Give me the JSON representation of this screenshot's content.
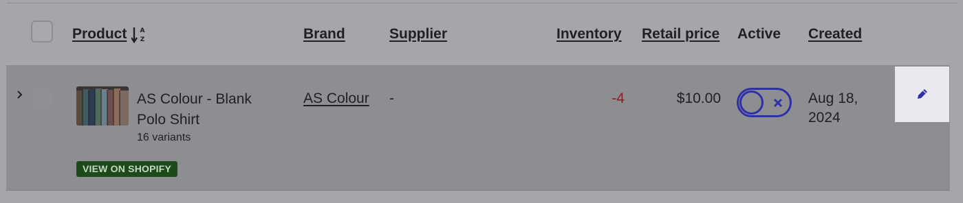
{
  "table": {
    "columns": {
      "product": "Product",
      "brand": "Brand",
      "supplier": "Supplier",
      "inventory": "Inventory",
      "retail_price": "Retail price",
      "active": "Active",
      "created": "Created"
    },
    "sort": {
      "column": "product",
      "direction": "ascending",
      "icon": "sort-alpha-down-icon"
    },
    "rows": [
      {
        "product_name": "AS Colour - Blank Polo Shirt",
        "variants": "16 variants",
        "badge": "VIEW ON SHOPIFY",
        "brand": "AS Colour",
        "supplier": "-",
        "inventory": "-4",
        "retail_price": "$10.00",
        "active": false,
        "created": "Aug 18, 2024"
      }
    ]
  },
  "icons": {
    "expand": "chevron-right-icon",
    "toggle_off": "close-icon",
    "edit": "pencil-icon"
  },
  "colors": {
    "accent": "#2d2fa8",
    "negative_value": "#8c1f1c",
    "badge_background": "#1c4a19",
    "row_background": "#8d8e92",
    "page_background": "#a5a6aa"
  }
}
